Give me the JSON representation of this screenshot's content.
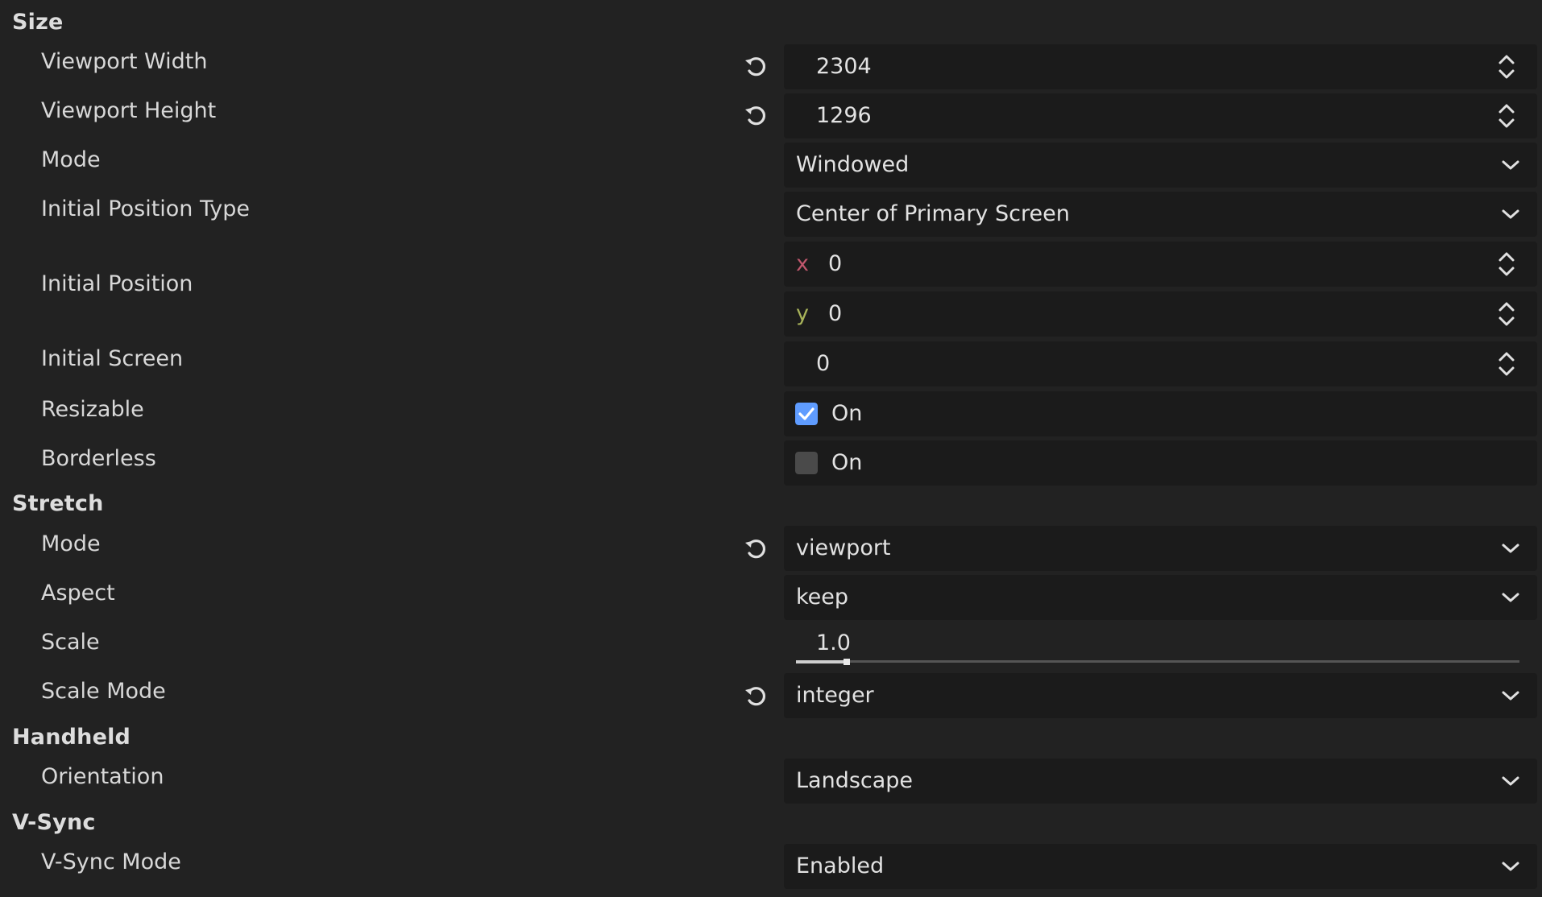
{
  "size": {
    "header": "Size",
    "viewport_width": {
      "label": "Viewport Width",
      "value": "2304"
    },
    "viewport_height": {
      "label": "Viewport Height",
      "value": "1296"
    },
    "mode": {
      "label": "Mode",
      "value": "Windowed"
    },
    "initial_position_type": {
      "label": "Initial Position Type",
      "value": "Center of Primary Screen"
    },
    "initial_position": {
      "label": "Initial Position",
      "x_label": "x",
      "x_value": "0",
      "y_label": "y",
      "y_value": "0"
    },
    "initial_screen": {
      "label": "Initial Screen",
      "value": "0"
    },
    "resizable": {
      "label": "Resizable",
      "state_label": "On",
      "checked": true
    },
    "borderless": {
      "label": "Borderless",
      "state_label": "On",
      "checked": false
    }
  },
  "stretch": {
    "header": "Stretch",
    "mode": {
      "label": "Mode",
      "value": "viewport"
    },
    "aspect": {
      "label": "Aspect",
      "value": "keep"
    },
    "scale": {
      "label": "Scale",
      "value": "1.0",
      "slider_fraction": 0.07
    },
    "scale_mode": {
      "label": "Scale Mode",
      "value": "integer"
    }
  },
  "handheld": {
    "header": "Handheld",
    "orientation": {
      "label": "Orientation",
      "value": "Landscape"
    }
  },
  "vsync": {
    "header": "V-Sync",
    "vsync_mode": {
      "label": "V-Sync Mode",
      "value": "Enabled"
    }
  },
  "icons": {
    "revert": "revert-icon",
    "spinner": "spinner-arrows-icon",
    "dropdown": "chevron-down-icon",
    "checkbox": "checkbox-icon"
  },
  "colors": {
    "background": "#222222",
    "field_background": "#1b1b1b",
    "checkbox_checked": "#5f9cff",
    "checkbox_unchecked": "#4a4a4a",
    "x_axis": "#c0576d",
    "y_axis": "#a8b35a"
  }
}
